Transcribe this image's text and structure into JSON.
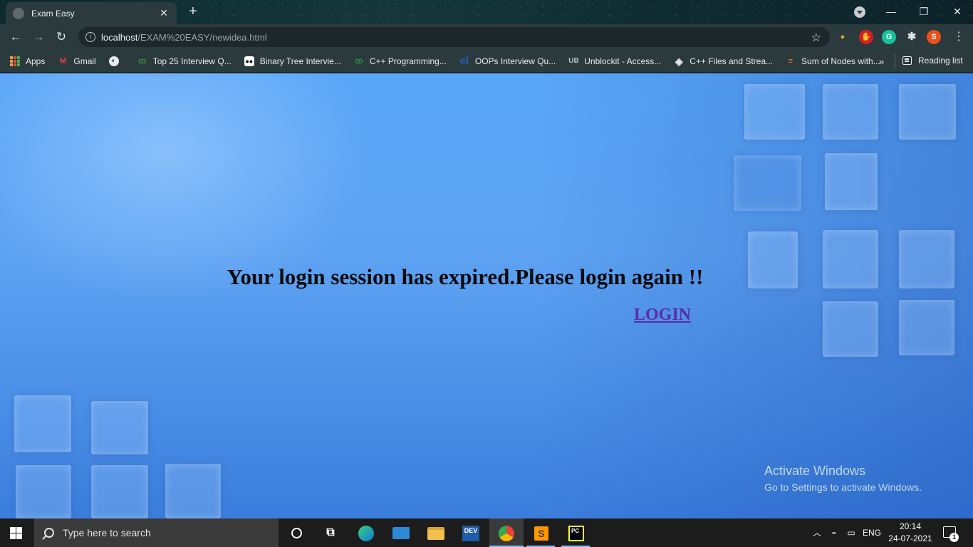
{
  "browser": {
    "tab_title": "Exam Easy",
    "tab_close": "✕",
    "new_tab": "+",
    "url_host": "localhost",
    "url_path": "/EXAM%20EASY/newidea.html",
    "profile_initial": "S",
    "extensions": [
      "lightbulb-extension-icon",
      "adblock-extension-icon",
      "grammarly-extension-icon",
      "puzzle-extensions-icon"
    ]
  },
  "bookmarks": {
    "items": [
      {
        "label": "Apps",
        "icon": "apps-grid-icon"
      },
      {
        "label": "Gmail",
        "icon": "gmail-icon"
      },
      {
        "label": "",
        "icon": "globe-icon"
      },
      {
        "label": "Top 25 Interview Q...",
        "icon": "geeksforgeeks-icon"
      },
      {
        "label": "Binary Tree Intervie...",
        "icon": "medium-icon"
      },
      {
        "label": "C++ Programming...",
        "icon": "geeksforgeeks-icon"
      },
      {
        "label": "OOPs Interview Qu...",
        "icon": "el-icon"
      },
      {
        "label": "Unblockit - Access...",
        "icon": "ub-icon"
      },
      {
        "label": "C++ Files and Strea...",
        "icon": "diamond-icon"
      },
      {
        "label": "Sum of Nodes with...",
        "icon": "stack-icon"
      }
    ],
    "more": "»",
    "reading_list": "Reading list"
  },
  "page": {
    "message": "Your login session has expired.Please login again !!",
    "login_link": "LOGIN"
  },
  "watermark": {
    "line1": "Activate Windows",
    "line2": "Go to Settings to activate Windows."
  },
  "taskbar": {
    "search_placeholder": "Type here to search",
    "language": "ENG",
    "time": "20:14",
    "date": "24-07-2021",
    "notification_count": "1",
    "pinned": [
      "cortana-icon",
      "task-view-icon",
      "edge-icon",
      "mail-icon",
      "file-explorer-icon",
      "dev-cpp-icon",
      "chrome-icon",
      "sublime-text-icon",
      "pycharm-icon"
    ]
  },
  "colors": {
    "chrome_toolbar": "#2b3a3c",
    "page_blue": "#5aa6f7",
    "login_link": "#5a2da6",
    "taskbar": "#1c1c1c"
  }
}
